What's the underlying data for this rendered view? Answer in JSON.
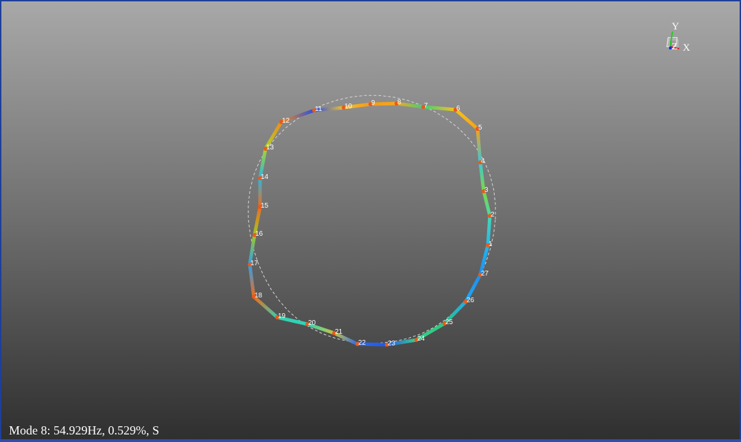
{
  "status": {
    "mode_text": "Mode 8: 54.929Hz, 0.529%, S"
  },
  "axes": {
    "y_label": "Y",
    "x_label": "X",
    "z_label": "Z",
    "y_color": "#22cc22",
    "x_color": "#dd2222",
    "z_color": "#1133dd"
  },
  "colors": {
    "undeformed_line": "#d8d8d8",
    "marker": "#e85a1a",
    "background_top": "#a8a8a8",
    "background_bottom": "#2f2f2f"
  },
  "nodes": [
    {
      "id": "1",
      "color": "#22b8f0"
    },
    {
      "id": "2",
      "color": "#4ad6b0"
    },
    {
      "id": "3",
      "color": "#7fd640"
    },
    {
      "id": "4",
      "color": "#3ec6d8"
    },
    {
      "id": "5",
      "color": "#f4a21a"
    },
    {
      "id": "6",
      "color": "#f7c21a"
    },
    {
      "id": "7",
      "color": "#3fcf7a"
    },
    {
      "id": "8",
      "color": "#f7a81c"
    },
    {
      "id": "9",
      "color": "#f49a18"
    },
    {
      "id": "10",
      "color": "#f0c030"
    },
    {
      "id": "11",
      "color": "#2a4fe0"
    },
    {
      "id": "12",
      "color": "#f08a1c"
    },
    {
      "id": "13",
      "color": "#a8d42a"
    },
    {
      "id": "14",
      "color": "#28b8e0"
    },
    {
      "id": "15",
      "color": "#f06a1c"
    },
    {
      "id": "16",
      "color": "#a0c828"
    },
    {
      "id": "17",
      "color": "#2aa0f0"
    },
    {
      "id": "18",
      "color": "#f06a1a"
    },
    {
      "id": "19",
      "color": "#36d0b0"
    },
    {
      "id": "20",
      "color": "#2ad6b8"
    },
    {
      "id": "21",
      "color": "#c8c440"
    },
    {
      "id": "22",
      "color": "#2a6af0"
    },
    {
      "id": "23",
      "color": "#1e58f0"
    },
    {
      "id": "24",
      "color": "#3ad08a"
    },
    {
      "id": "25",
      "color": "#2ac880"
    },
    {
      "id": "26",
      "color": "#22a8f0"
    },
    {
      "id": "27",
      "color": "#1e8ef0"
    }
  ]
}
